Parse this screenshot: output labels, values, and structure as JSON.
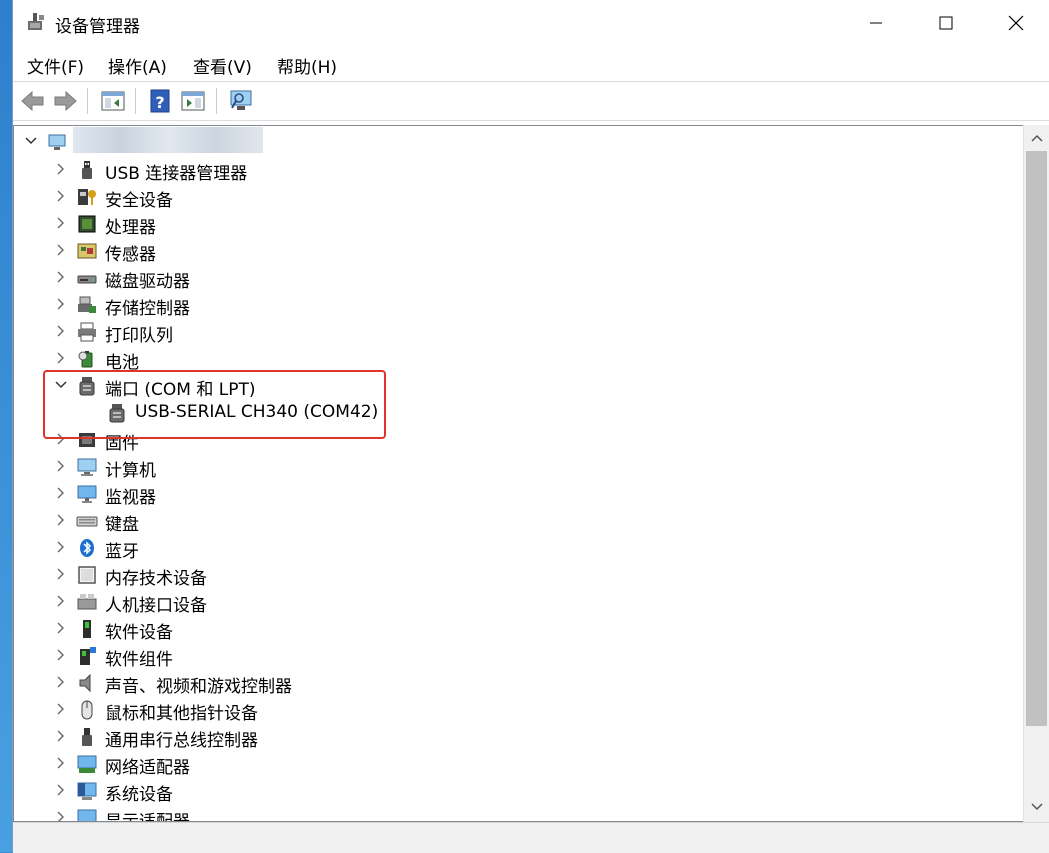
{
  "window": {
    "title": "设备管理器",
    "minimize_glyph": "—",
    "maximize_glyph": "☐",
    "close_glyph": "✕"
  },
  "menu": [
    {
      "label": "文件(F)"
    },
    {
      "label": "操作(A)"
    },
    {
      "label": "查看(V)"
    },
    {
      "label": "帮助(H)"
    }
  ],
  "toolbar": {
    "icons": [
      "back-arrow-icon",
      "forward-arrow-icon",
      "show-hide-console-tree-icon",
      "help-icon",
      "properties-pane-icon",
      "scan-hardware-changes-icon"
    ]
  },
  "tree": {
    "root_label": "",
    "items": [
      {
        "label": "USB 连接器管理器",
        "icon": "usb-connector-icon",
        "expanded": false
      },
      {
        "label": "安全设备",
        "icon": "security-device-icon",
        "expanded": false
      },
      {
        "label": "处理器",
        "icon": "processor-icon",
        "expanded": false
      },
      {
        "label": "传感器",
        "icon": "sensor-icon",
        "expanded": false
      },
      {
        "label": "磁盘驱动器",
        "icon": "disk-drive-icon",
        "expanded": false
      },
      {
        "label": "存储控制器",
        "icon": "storage-controller-icon",
        "expanded": false
      },
      {
        "label": "打印队列",
        "icon": "printer-icon",
        "expanded": false
      },
      {
        "label": "电池",
        "icon": "battery-icon",
        "expanded": false
      },
      {
        "label": "端口 (COM 和 LPT)",
        "icon": "port-icon",
        "expanded": true,
        "children": [
          {
            "label": "USB-SERIAL CH340 (COM42)",
            "icon": "port-icon"
          }
        ]
      },
      {
        "label": "固件",
        "icon": "firmware-icon",
        "expanded": false
      },
      {
        "label": "计算机",
        "icon": "computer-icon",
        "expanded": false
      },
      {
        "label": "监视器",
        "icon": "monitor-icon",
        "expanded": false
      },
      {
        "label": "键盘",
        "icon": "keyboard-icon",
        "expanded": false
      },
      {
        "label": "蓝牙",
        "icon": "bluetooth-icon",
        "expanded": false
      },
      {
        "label": "内存技术设备",
        "icon": "memory-tech-icon",
        "expanded": false
      },
      {
        "label": "人机接口设备",
        "icon": "hid-icon",
        "expanded": false
      },
      {
        "label": "软件设备",
        "icon": "software-device-icon",
        "expanded": false
      },
      {
        "label": "软件组件",
        "icon": "software-component-icon",
        "expanded": false
      },
      {
        "label": "声音、视频和游戏控制器",
        "icon": "sound-icon",
        "expanded": false
      },
      {
        "label": "鼠标和其他指针设备",
        "icon": "mouse-icon",
        "expanded": false
      },
      {
        "label": "通用串行总线控制器",
        "icon": "usb-controller-icon",
        "expanded": false
      },
      {
        "label": "网络适配器",
        "icon": "network-adapter-icon",
        "expanded": false
      },
      {
        "label": "系统设备",
        "icon": "system-device-icon",
        "expanded": false
      },
      {
        "label": "显示适配器",
        "icon": "display-adapter-icon",
        "expanded": false
      }
    ]
  },
  "colors": {
    "highlight_border": "#e0342a",
    "scrollbar_thumb": "#c1c1c1"
  }
}
